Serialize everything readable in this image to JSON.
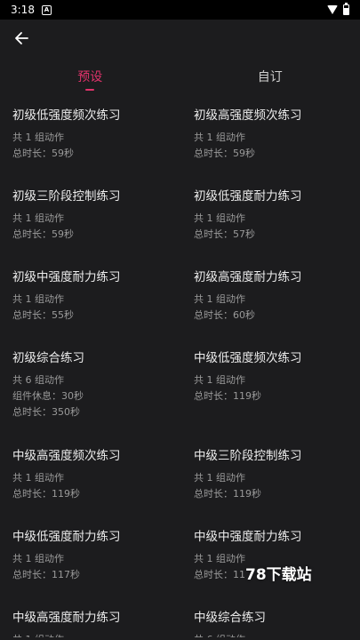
{
  "status_bar": {
    "time": "3:18",
    "app_icon": "A"
  },
  "tabs": [
    {
      "label": "预设",
      "active": true
    },
    {
      "label": "自订",
      "active": false
    }
  ],
  "cards": [
    {
      "title": "初级低强度频次练习",
      "lines": [
        "共 1 组动作",
        "总时长：59秒"
      ]
    },
    {
      "title": "初级高强度频次练习",
      "lines": [
        "共 1 组动作",
        "总时长：59秒"
      ]
    },
    {
      "title": "初级三阶段控制练习",
      "lines": [
        "共 1 组动作",
        "总时长：59秒"
      ]
    },
    {
      "title": "初级低强度耐力练习",
      "lines": [
        "共 1 组动作",
        "总时长：57秒"
      ]
    },
    {
      "title": "初级中强度耐力练习",
      "lines": [
        "共 1 组动作",
        "总时长：55秒"
      ]
    },
    {
      "title": "初级高强度耐力练习",
      "lines": [
        "共 1 组动作",
        "总时长：60秒"
      ]
    },
    {
      "title": "初级综合练习",
      "lines": [
        "共 6 组动作",
        "组件休息：30秒",
        "总时长：350秒"
      ]
    },
    {
      "title": "中级低强度频次练习",
      "lines": [
        "共 1 组动作",
        "总时长：119秒"
      ]
    },
    {
      "title": "中级高强度频次练习",
      "lines": [
        "共 1 组动作",
        "总时长：119秒"
      ]
    },
    {
      "title": "中级三阶段控制练习",
      "lines": [
        "共 1 组动作",
        "总时长：119秒"
      ]
    },
    {
      "title": "中级低强度耐力练习",
      "lines": [
        "共 1 组动作",
        "总时长：117秒"
      ]
    },
    {
      "title": "中级中强度耐力练习",
      "lines": [
        "共 1 组动作",
        "总时长：11"
      ]
    },
    {
      "title": "中级高强度耐力练习",
      "lines": [
        "共 1 组动作"
      ]
    },
    {
      "title": "中级综合练习",
      "lines": [
        "共 6 组动作"
      ]
    }
  ],
  "watermark": "78下载站",
  "colors": {
    "accent": "#e0336b",
    "background": "#1c1c1e"
  }
}
